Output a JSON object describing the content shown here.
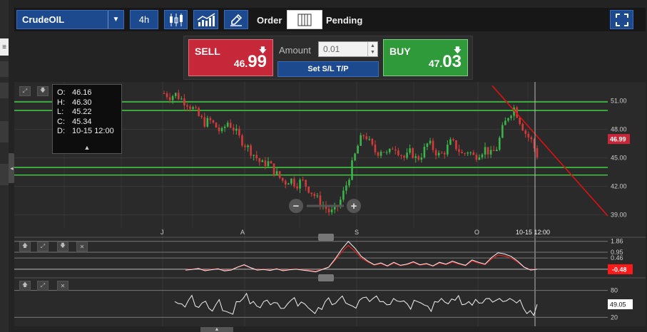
{
  "toolbar": {
    "symbol": "CrudeOIL",
    "timeframe": "4h",
    "order_label": "Order",
    "pending_label": "Pending",
    "icons": [
      "chevron-down-icon",
      "candlestick-icon",
      "indicator-chart-icon",
      "pencil-icon",
      "columns-icon",
      "fullscreen-icon"
    ]
  },
  "order_panel": {
    "sell": {
      "label": "SELL",
      "price_prefix": "46.",
      "price_main": "99"
    },
    "buy": {
      "label": "BUY",
      "price_prefix": "47.",
      "price_main": "03"
    },
    "amount_label": "Amount",
    "amount_value": "0.01",
    "sltp_label": "Set S/L T/P"
  },
  "ohlc": {
    "rows": [
      {
        "k": "O:",
        "v": "46.16"
      },
      {
        "k": "H:",
        "v": "46.30"
      },
      {
        "k": "L:",
        "v": "45.22"
      },
      {
        "k": "C:",
        "v": "45.34"
      },
      {
        "k": "D:",
        "v": "10-15 12:00"
      }
    ]
  },
  "price_axis": {
    "labels": [
      "51.00",
      "48.00",
      "45.00",
      "42.00",
      "39.00"
    ],
    "current_price": "46.99",
    "current_color": "#c62839"
  },
  "time_axis": {
    "labels": [
      "J",
      "A",
      "S",
      "O"
    ],
    "cursor_label": "10-15 12:00"
  },
  "indicator1": {
    "labels": [
      "1.86",
      "0.95",
      "0.46"
    ],
    "value": "-0.48",
    "value_color": "#ff1a1a"
  },
  "indicator2": {
    "labels": [
      "80",
      "20"
    ],
    "value": "49.05"
  },
  "colors": {
    "level_lines": "#3fd13f",
    "trend_line": "#e01010",
    "bull": "#3ab54a",
    "bear": "#d43a3a"
  },
  "chart_data": {
    "type": "candlestick",
    "symbol": "CrudeOIL",
    "timeframe": "4h",
    "ylim": [
      38,
      53
    ],
    "yticks": [
      51,
      48,
      45,
      42,
      39
    ],
    "x_labels": [
      "J",
      "A",
      "S",
      "O"
    ],
    "horizontal_levels": [
      50.9,
      50.0,
      44.0,
      43.2
    ],
    "trend_line": {
      "from_price": 52.6,
      "to_price": 38.9
    },
    "close_path": [
      51.8,
      51.5,
      51.7,
      51.2,
      50.8,
      50.2,
      49.4,
      48.7,
      48.9,
      48.3,
      47.6,
      48.8,
      48.2,
      47.2,
      46.5,
      45.8,
      45.1,
      44.3,
      44.6,
      43.8,
      43.0,
      42.4,
      42.8,
      42.2,
      42.6,
      41.9,
      41.2,
      40.4,
      39.8,
      39.2,
      39.6,
      40.9,
      42.6,
      44.8,
      46.7,
      47.6,
      46.3,
      45.5,
      46.0,
      45.2,
      46.4,
      45.6,
      44.9,
      45.7,
      44.8,
      45.5,
      46.6,
      45.9,
      45.2,
      45.8,
      46.7,
      46.1,
      45.3,
      45.8,
      45.1,
      45.6,
      46.0,
      45.3,
      46.1,
      48.1,
      49.5,
      50.3,
      48.9,
      47.6,
      46.8,
      45.3
    ],
    "indicator1_path": [
      -0.55,
      -0.5,
      -0.42,
      -0.6,
      -0.52,
      -0.45,
      -0.62,
      -0.55,
      -0.3,
      -0.1,
      -0.35,
      -0.55,
      -0.5,
      -0.58,
      -0.45,
      -0.6,
      -0.52,
      -0.48,
      -0.55,
      -0.62,
      -0.7,
      -0.5,
      -0.3,
      0.4,
      1.2,
      1.85,
      1.3,
      0.6,
      0.2,
      -0.1,
      0.05,
      -0.2,
      0.1,
      -0.15,
      -0.05,
      0.15,
      -0.1,
      0.0,
      -0.2,
      0.1,
      -0.05,
      0.2,
      0.0,
      -0.15,
      0.3,
      0.1,
      -0.05,
      0.5,
      0.9,
      0.8,
      0.6,
      0.2,
      -0.3,
      -0.55,
      -0.48
    ],
    "indicator2_path": [
      55,
      50,
      58,
      45,
      52,
      40,
      48,
      35,
      30,
      55,
      62,
      50,
      45,
      55,
      48,
      52,
      40,
      58,
      45,
      50,
      35,
      42,
      55,
      48,
      60,
      52,
      45,
      58,
      65,
      62,
      55,
      48,
      62,
      55,
      50,
      58,
      52,
      45,
      55,
      62,
      50,
      58,
      48,
      55,
      60,
      52,
      62,
      58,
      55,
      62,
      52,
      40,
      35,
      49
    ]
  }
}
